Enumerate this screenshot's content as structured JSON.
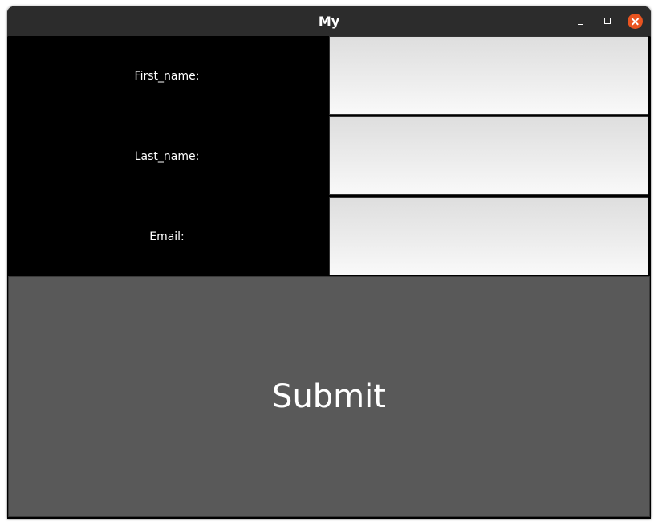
{
  "window": {
    "title": "My",
    "controls": {
      "minimize_icon": "minimize-icon",
      "maximize_icon": "maximize-icon",
      "close_icon": "close-icon"
    },
    "close_color": "#e95420"
  },
  "form": {
    "fields": [
      {
        "label": "First_name:",
        "value": "",
        "placeholder": ""
      },
      {
        "label": "Last_name:",
        "value": "",
        "placeholder": ""
      },
      {
        "label": "Email:",
        "value": "",
        "placeholder": ""
      }
    ],
    "submit_label": "Submit"
  },
  "colors": {
    "background": "#000000",
    "label_text": "#ffffff",
    "submit_background": "#595959",
    "titlebar": "#2c2c2c"
  }
}
